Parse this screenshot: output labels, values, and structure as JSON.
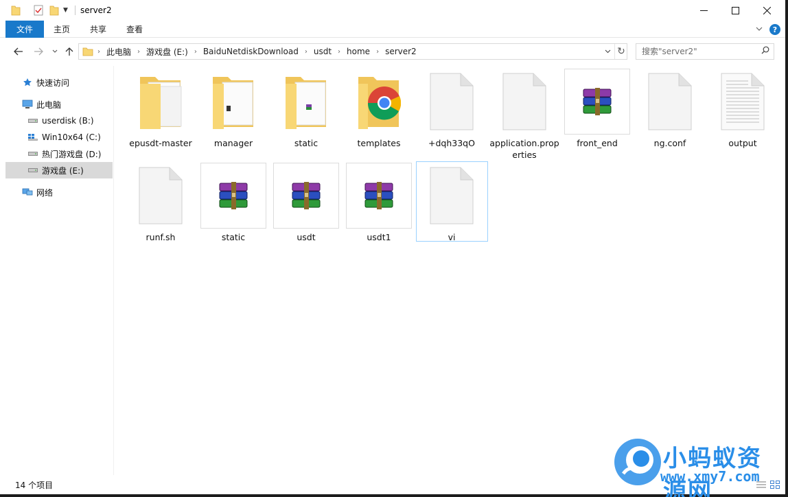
{
  "window": {
    "title": "server2",
    "minimize": "—",
    "maximize": "☐",
    "close": "✕"
  },
  "ribbon": {
    "tabs": [
      "文件",
      "主页",
      "共享",
      "查看"
    ],
    "expand": "⌄",
    "help": "?"
  },
  "nav": {
    "back": "←",
    "forward": "→",
    "recent": "⌄",
    "up": "↑",
    "breadcrumbs": [
      "此电脑",
      "游戏盘 (E:)",
      "BaiduNetdiskDownload",
      "usdt",
      "home",
      "server2"
    ],
    "breadcrumb_sep": "›",
    "dropdown": "⌄",
    "refresh": "↻"
  },
  "search": {
    "placeholder": "搜索\"server2\""
  },
  "sidebar": {
    "items": [
      {
        "label": "快速访问",
        "icon": "star-icon"
      },
      {
        "label": "此电脑",
        "icon": "computer-icon"
      },
      {
        "label": "userdisk (B:)",
        "icon": "drive-icon"
      },
      {
        "label": "Win10x64 (C:)",
        "icon": "windows-drive-icon"
      },
      {
        "label": "热门游戏盘 (D:)",
        "icon": "drive-icon"
      },
      {
        "label": "游戏盘 (E:)",
        "icon": "drive-icon",
        "selected": true
      },
      {
        "label": "网络",
        "icon": "network-icon"
      }
    ]
  },
  "files": [
    {
      "name": "epusdt-master",
      "type": "folder"
    },
    {
      "name": "manager",
      "type": "folder"
    },
    {
      "name": "static",
      "type": "folder"
    },
    {
      "name": "templates",
      "type": "folder-chrome"
    },
    {
      "name": "+dqh33qO",
      "type": "file"
    },
    {
      "name": "application.properties",
      "type": "file"
    },
    {
      "name": "front_end",
      "type": "archive"
    },
    {
      "name": "ng.conf",
      "type": "file"
    },
    {
      "name": "output",
      "type": "text-file"
    },
    {
      "name": "runf.sh",
      "type": "file"
    },
    {
      "name": "static",
      "type": "archive"
    },
    {
      "name": "usdt",
      "type": "archive"
    },
    {
      "name": "usdt1",
      "type": "archive"
    },
    {
      "name": "vi",
      "type": "file",
      "selected": true
    }
  ],
  "status": {
    "count_text": "14 个项目"
  },
  "watermark": {
    "title": "小蚂蚁资源网",
    "url": "www.xmy7.com"
  },
  "colors": {
    "accent": "#1979ca",
    "folder": "#f8d775",
    "selection": "#99d1ff",
    "watermark": "#2a8ee8"
  }
}
